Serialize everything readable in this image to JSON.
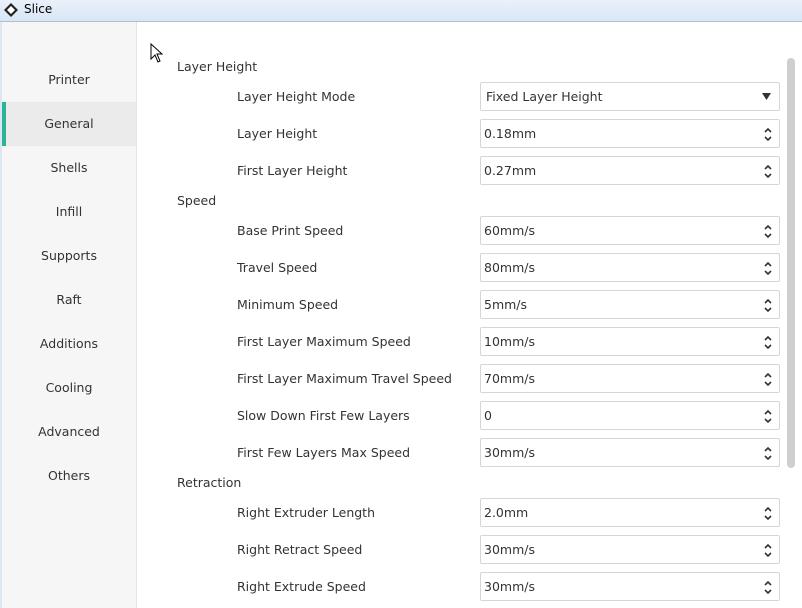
{
  "window": {
    "title": "Slice",
    "app_icon": "slice-diamond-icon"
  },
  "sidebar": {
    "active_index": 1,
    "accent_color": "#2bb596",
    "items": [
      {
        "label": "Printer"
      },
      {
        "label": "General"
      },
      {
        "label": "Shells"
      },
      {
        "label": "Infill"
      },
      {
        "label": "Supports"
      },
      {
        "label": "Raft"
      },
      {
        "label": "Additions"
      },
      {
        "label": "Cooling"
      },
      {
        "label": "Advanced"
      },
      {
        "label": "Others"
      }
    ]
  },
  "sections": [
    {
      "title": "Layer Height",
      "rows": [
        {
          "label": "Layer Height Mode",
          "value": "Fixed Layer Height",
          "control": "dropdown"
        },
        {
          "label": "Layer Height",
          "value": "0.18mm",
          "control": "spinbox"
        },
        {
          "label": "First Layer Height",
          "value": "0.27mm",
          "control": "spinbox"
        }
      ]
    },
    {
      "title": "Speed",
      "rows": [
        {
          "label": "Base Print Speed",
          "value": "60mm/s",
          "control": "spinbox"
        },
        {
          "label": "Travel Speed",
          "value": "80mm/s",
          "control": "spinbox"
        },
        {
          "label": "Minimum Speed",
          "value": "5mm/s",
          "control": "spinbox"
        },
        {
          "label": "First Layer Maximum Speed",
          "value": "10mm/s",
          "control": "spinbox"
        },
        {
          "label": "First Layer Maximum Travel Speed",
          "value": "70mm/s",
          "control": "spinbox"
        },
        {
          "label": "Slow Down First Few Layers",
          "value": "0",
          "control": "spinbox"
        },
        {
          "label": "First Few Layers Max Speed",
          "value": "30mm/s",
          "control": "spinbox"
        }
      ]
    },
    {
      "title": "Retraction",
      "rows": [
        {
          "label": "Right Extruder Length",
          "value": "2.0mm",
          "control": "spinbox"
        },
        {
          "label": "Right Retract Speed",
          "value": "30mm/s",
          "control": "spinbox"
        },
        {
          "label": "Right Extrude Speed",
          "value": "30mm/s",
          "control": "spinbox"
        }
      ]
    }
  ]
}
